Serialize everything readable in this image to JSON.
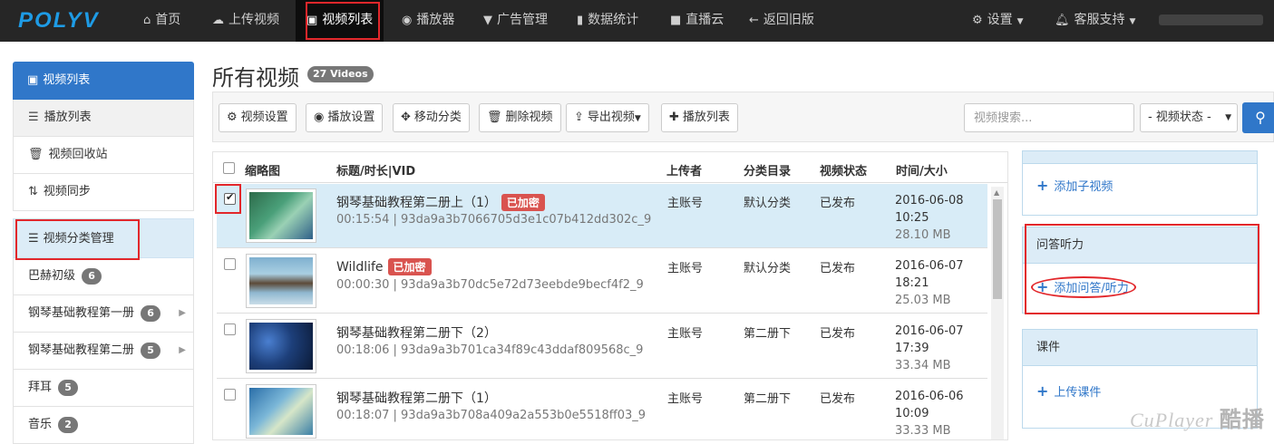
{
  "nav": {
    "logo": "POLYV",
    "items": [
      {
        "label": "首页",
        "icon": "home-icon"
      },
      {
        "label": "上传视频",
        "icon": "cloud-upload-icon"
      },
      {
        "label": "视频列表",
        "icon": "film-icon"
      },
      {
        "label": "播放器",
        "icon": "play-circle-icon"
      },
      {
        "label": "广告管理",
        "icon": "filter-icon"
      },
      {
        "label": "数据统计",
        "icon": "bar-chart-icon"
      },
      {
        "label": "直播云",
        "icon": "video-camera-icon"
      },
      {
        "label": "返回旧版",
        "icon": "arrow-left-icon"
      }
    ],
    "settings": "设置",
    "support": "客服支持"
  },
  "sidebar": {
    "head": "视频列表",
    "items": [
      {
        "label": "播放列表",
        "icon": "list-icon"
      },
      {
        "label": "视频回收站",
        "icon": "trash-icon"
      },
      {
        "label": "视频同步",
        "icon": "sync-icon"
      }
    ],
    "category_head": "视频分类管理",
    "categories": [
      {
        "label": "巴赫初级",
        "count": "6"
      },
      {
        "label": "钢琴基础教程第一册",
        "count": "6"
      },
      {
        "label": "钢琴基础教程第二册",
        "count": "5"
      },
      {
        "label": "拜耳",
        "count": "5"
      },
      {
        "label": "音乐",
        "count": "2"
      }
    ]
  },
  "main": {
    "title": "所有视频",
    "count_badge": "27 Videos",
    "toolbar": {
      "video_settings": "视频设置",
      "play_settings": "播放设置",
      "move_category": "移动分类",
      "delete_video": "删除视频",
      "export_video": "导出视频",
      "playlist": "播放列表",
      "search_placeholder": "视频搜索...",
      "status_select": "- 视频状态 -"
    },
    "table": {
      "headers": {
        "thumb": "缩略图",
        "title": "标题/时长|VID",
        "uploader": "上传者",
        "category": "分类目录",
        "status": "视频状态",
        "time": "时间/大小"
      },
      "rows": [
        {
          "title": "钢琴基础教程第二册上（1）",
          "encrypted": "已加密",
          "meta": "00:15:54 | 93da9a3b7066705d3e1c07b412dd302c_9",
          "uploader": "主账号",
          "category": "默认分类",
          "status": "已发布",
          "date": "2016-06-08",
          "time": "10:25",
          "size": "28.10 MB",
          "checked": true
        },
        {
          "title": "Wildlife",
          "encrypted": "已加密",
          "meta": "00:00:30 | 93da9a3b70dc5e72d73eebde9becf4f2_9",
          "uploader": "主账号",
          "category": "默认分类",
          "status": "已发布",
          "date": "2016-06-07",
          "time": "18:21",
          "size": "25.03 MB",
          "checked": false
        },
        {
          "title": "钢琴基础教程第二册下（2）",
          "encrypted": "",
          "meta": "00:18:06 | 93da9a3b701ca34f89c43ddaf809568c_9",
          "uploader": "主账号",
          "category": "第二册下",
          "status": "已发布",
          "date": "2016-06-07",
          "time": "17:39",
          "size": "33.34 MB",
          "checked": false
        },
        {
          "title": "钢琴基础教程第二册下（1）",
          "encrypted": "",
          "meta": "00:18:07 | 93da9a3b708a409a2a553b0e5518ff03_9",
          "uploader": "主账号",
          "category": "第二册下",
          "status": "已发布",
          "date": "2016-06-06",
          "time": "10:09",
          "size": "33.33 MB",
          "checked": false
        }
      ]
    }
  },
  "right": {
    "add_sub_video": "添加子视频",
    "qa_head": "问答听力",
    "add_qa": "添加问答/听力",
    "courseware_head": "课件",
    "upload_courseware": "上传课件"
  },
  "watermark": {
    "text": "CuPlayer",
    "cn": "酷播"
  },
  "colors": {
    "accent": "#3077c9",
    "danger": "#d9534f",
    "nav_bg": "#262626",
    "highlight": "#d8ecf7"
  }
}
